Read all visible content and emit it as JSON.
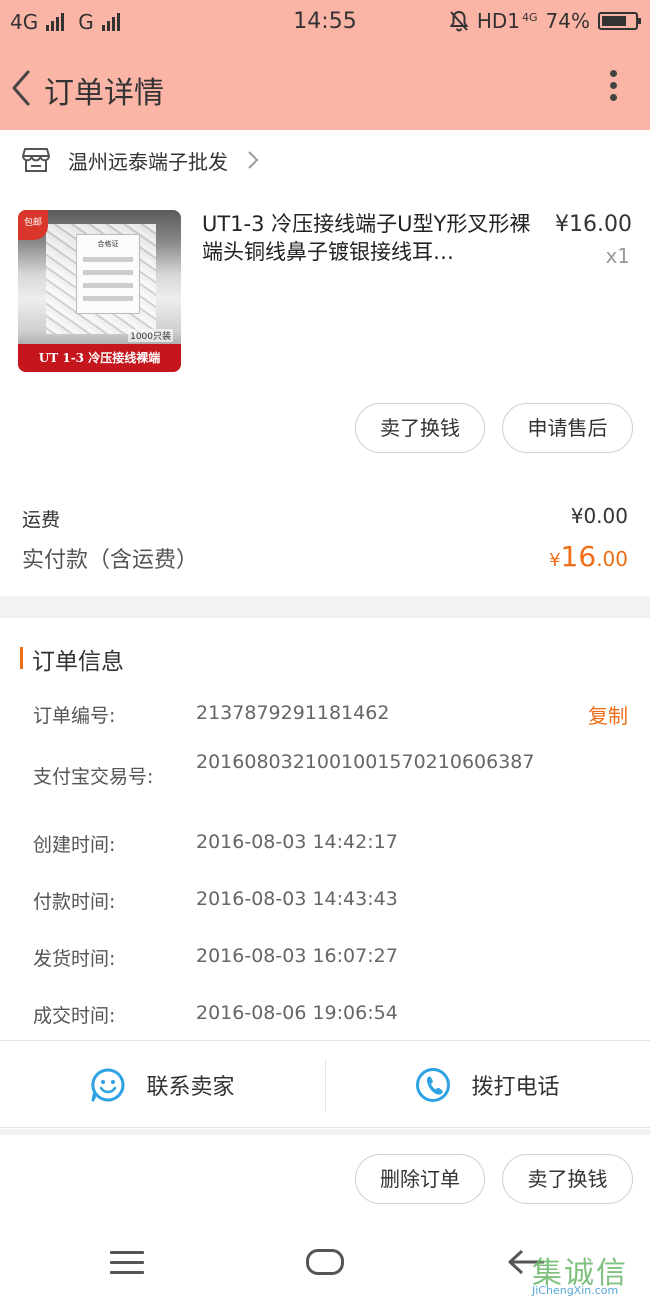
{
  "status_bar": {
    "network_1": "4G",
    "network_2": "G",
    "time": "14:55",
    "hd_label": "HD1",
    "lte_label": "4G",
    "battery": "74%",
    "battery_level": 0.74
  },
  "header": {
    "title": "订单详情"
  },
  "shop": {
    "name": "温州远泰端子批发"
  },
  "product": {
    "title": "UT1-3 冷压接线端子U型Y形叉形裸端头铜线鼻子镀银接线耳…",
    "price": "¥16.00",
    "quantity": "x1",
    "image": {
      "badge": "包邮",
      "banner": "UT 1-3  冷压接线裸端",
      "pack": "1000只装",
      "card_title": "合格证"
    }
  },
  "item_actions": {
    "sell_label": "卖了换钱",
    "after_sale_label": "申请售后"
  },
  "fees": {
    "shipping_label": "运费",
    "shipping_value": "¥0.00",
    "total_label": "实付款（含运费）",
    "total_currency": "¥",
    "total_integer": "16",
    "total_decimal": ".00"
  },
  "order_info": {
    "section_title": "订单信息",
    "copy_label": "复制",
    "rows": [
      {
        "label": "订单编号:",
        "value": "2137879291181462"
      },
      {
        "label": "支付宝交易号:",
        "value": "2016080321001001570210606387"
      },
      {
        "label": "创建时间:",
        "value": "2016-08-03 14:42:17"
      },
      {
        "label": "付款时间:",
        "value": "2016-08-03 14:43:43"
      },
      {
        "label": "发货时间:",
        "value": "2016-08-03 16:07:27"
      },
      {
        "label": "成交时间:",
        "value": "2016-08-06 19:06:54"
      }
    ]
  },
  "contact": {
    "seller_label": "联系卖家",
    "call_label": "拨打电话"
  },
  "bottom_actions": {
    "delete_label": "删除订单",
    "sell_label": "卖了换钱"
  },
  "watermark": {
    "cn": "集诚信",
    "en": "JiChengXin.com"
  },
  "colors": {
    "header_bg": "#fbb5a7",
    "accent": "#f06d18",
    "icon_blue": "#2ea3e3"
  }
}
